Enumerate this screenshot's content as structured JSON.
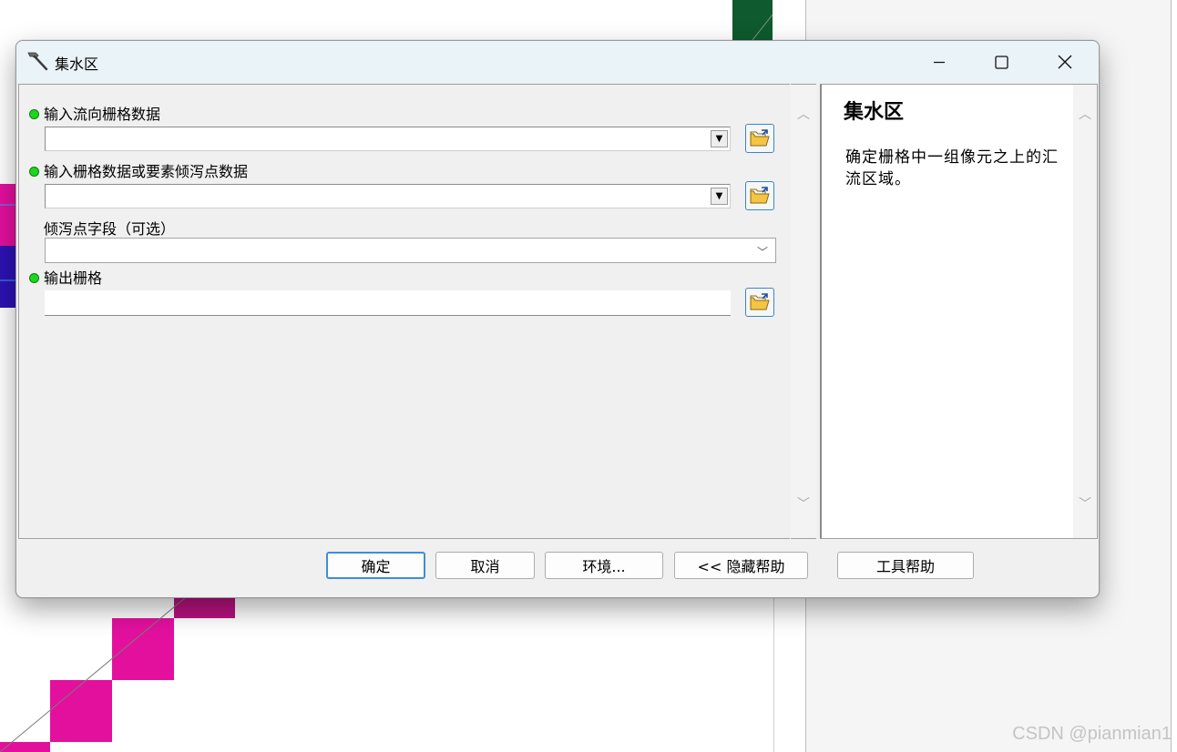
{
  "window": {
    "title": "集水区",
    "minimize_label": "最小化",
    "maximize_label": "最大化",
    "close_label": "关闭"
  },
  "form": {
    "flow_direction": {
      "label": "输入流向栅格数据",
      "required": true,
      "value": "",
      "control": "dropdown-with-browse"
    },
    "pour_point": {
      "label": "输入栅格数据或要素倾泻点数据",
      "required": true,
      "value": "",
      "control": "dropdown-with-browse"
    },
    "pour_point_field": {
      "label": "倾泻点字段（可选）",
      "required": false,
      "value": "",
      "control": "select"
    },
    "output_raster": {
      "label": "输出栅格",
      "required": true,
      "value": "",
      "control": "text-with-browse"
    }
  },
  "help": {
    "title": "集水区",
    "description": "确定栅格中一组像元之上的汇流区域。"
  },
  "buttons": {
    "ok": "确定",
    "cancel": "取消",
    "environments": "环境...",
    "hide_help": "<< 隐藏帮助",
    "tool_help": "工具帮助"
  },
  "watermark": "CSDN @pianmian1",
  "icons": {
    "title": "hammer-icon",
    "browse": "open-folder-icon",
    "required": "green-dot-icon"
  },
  "colors": {
    "accent": "#3c8fd6",
    "required_dot": "#1fd61f",
    "map_magenta": "#e0109a",
    "map_blue": "#2a10b0",
    "map_green": "#0f5a2e"
  }
}
